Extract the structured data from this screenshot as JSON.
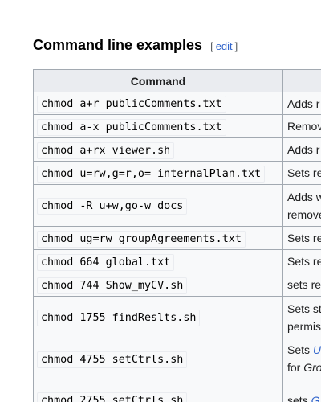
{
  "section": {
    "title": "Command line examples",
    "edit_open": "[",
    "edit_label": "edit",
    "edit_close": "]"
  },
  "table": {
    "headers": [
      "Command",
      ""
    ],
    "rows": [
      {
        "command": "chmod a+r publicComments.txt",
        "description": "Adds r"
      },
      {
        "command": "chmod a-x publicComments.txt",
        "description": "Remov"
      },
      {
        "command": "chmod a+rx viewer.sh",
        "description": "Adds r"
      },
      {
        "command": "chmod u=rw,g=r,o= internalPlan.txt",
        "description": "Sets re"
      },
      {
        "command": "chmod -R u+w,go-w docs",
        "description": "Adds w",
        "description2": "remove"
      },
      {
        "command": "chmod ug=rw groupAgreements.txt",
        "description": "Sets re"
      },
      {
        "command": "chmod 664 global.txt",
        "description": "Sets re"
      },
      {
        "command": "chmod 744 Show_myCV.sh",
        "description": "sets re"
      },
      {
        "command": "chmod 1755 findReslts.sh",
        "description": "Sets st",
        "description2": "permis"
      },
      {
        "command": "chmod 4755 setCtrls.sh",
        "description": "Sets ",
        "description_link": "U",
        "description2_prefix": "for ",
        "description2_italic": "Gro"
      },
      {
        "command": "chmod 2755 setCtrls.sh",
        "description": "sets ",
        "description_link": "G"
      }
    ]
  }
}
